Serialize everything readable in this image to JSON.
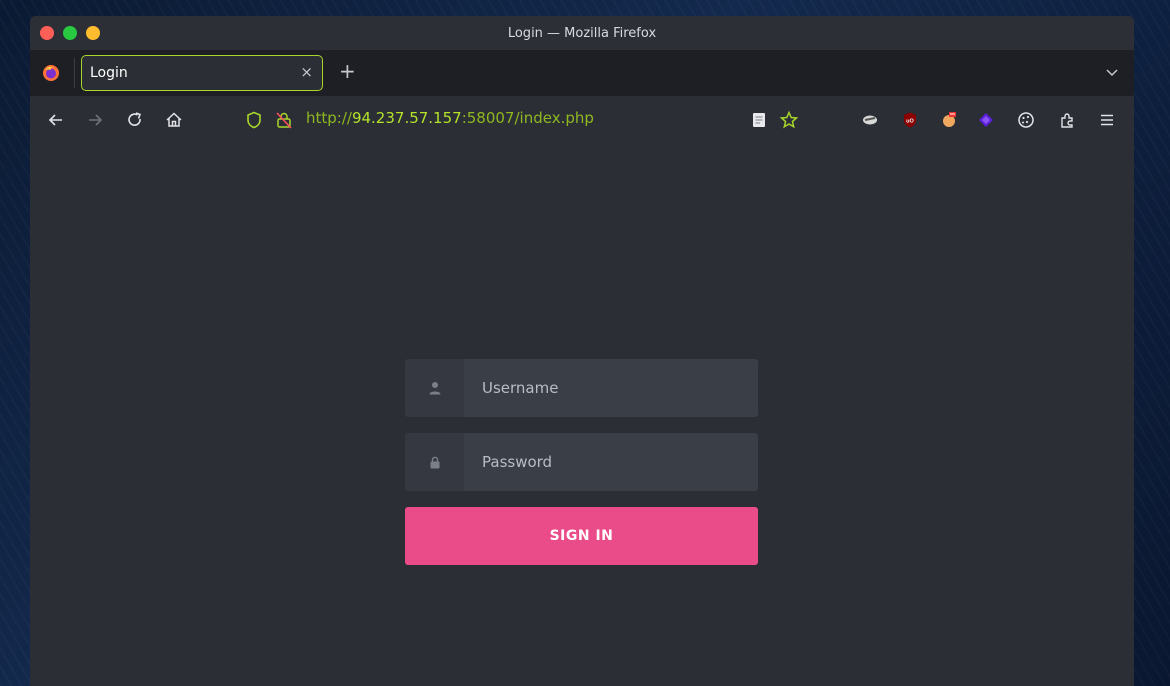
{
  "window": {
    "title": "Login — Mozilla Firefox"
  },
  "tab": {
    "label": "Login",
    "close_glyph": "×",
    "new_tab_glyph": "+"
  },
  "address": {
    "scheme": "http://",
    "host": "94.237.57.157",
    "rest": ":58007/index.php"
  },
  "form": {
    "username_placeholder": "Username",
    "password_placeholder": "Password",
    "submit_label": "SIGN IN"
  },
  "colors": {
    "accent_green": "#a9d62b",
    "button_pink": "#ea4c89",
    "traffic_red": "#ff5f57",
    "traffic_green": "#28c840",
    "traffic_yellow": "#febc2e"
  },
  "icons": {
    "toolbar": [
      "back-icon",
      "forward-icon",
      "reload-icon",
      "home-icon",
      "shield-icon",
      "insecure-lock-icon"
    ],
    "extensions": [
      "reader-view-icon",
      "bookmark-star-icon",
      "extension-icon",
      "ublock-icon",
      "extension-icon",
      "extension-icon",
      "cookie-icon",
      "extensions-puzzle-icon",
      "menu-icon"
    ]
  }
}
